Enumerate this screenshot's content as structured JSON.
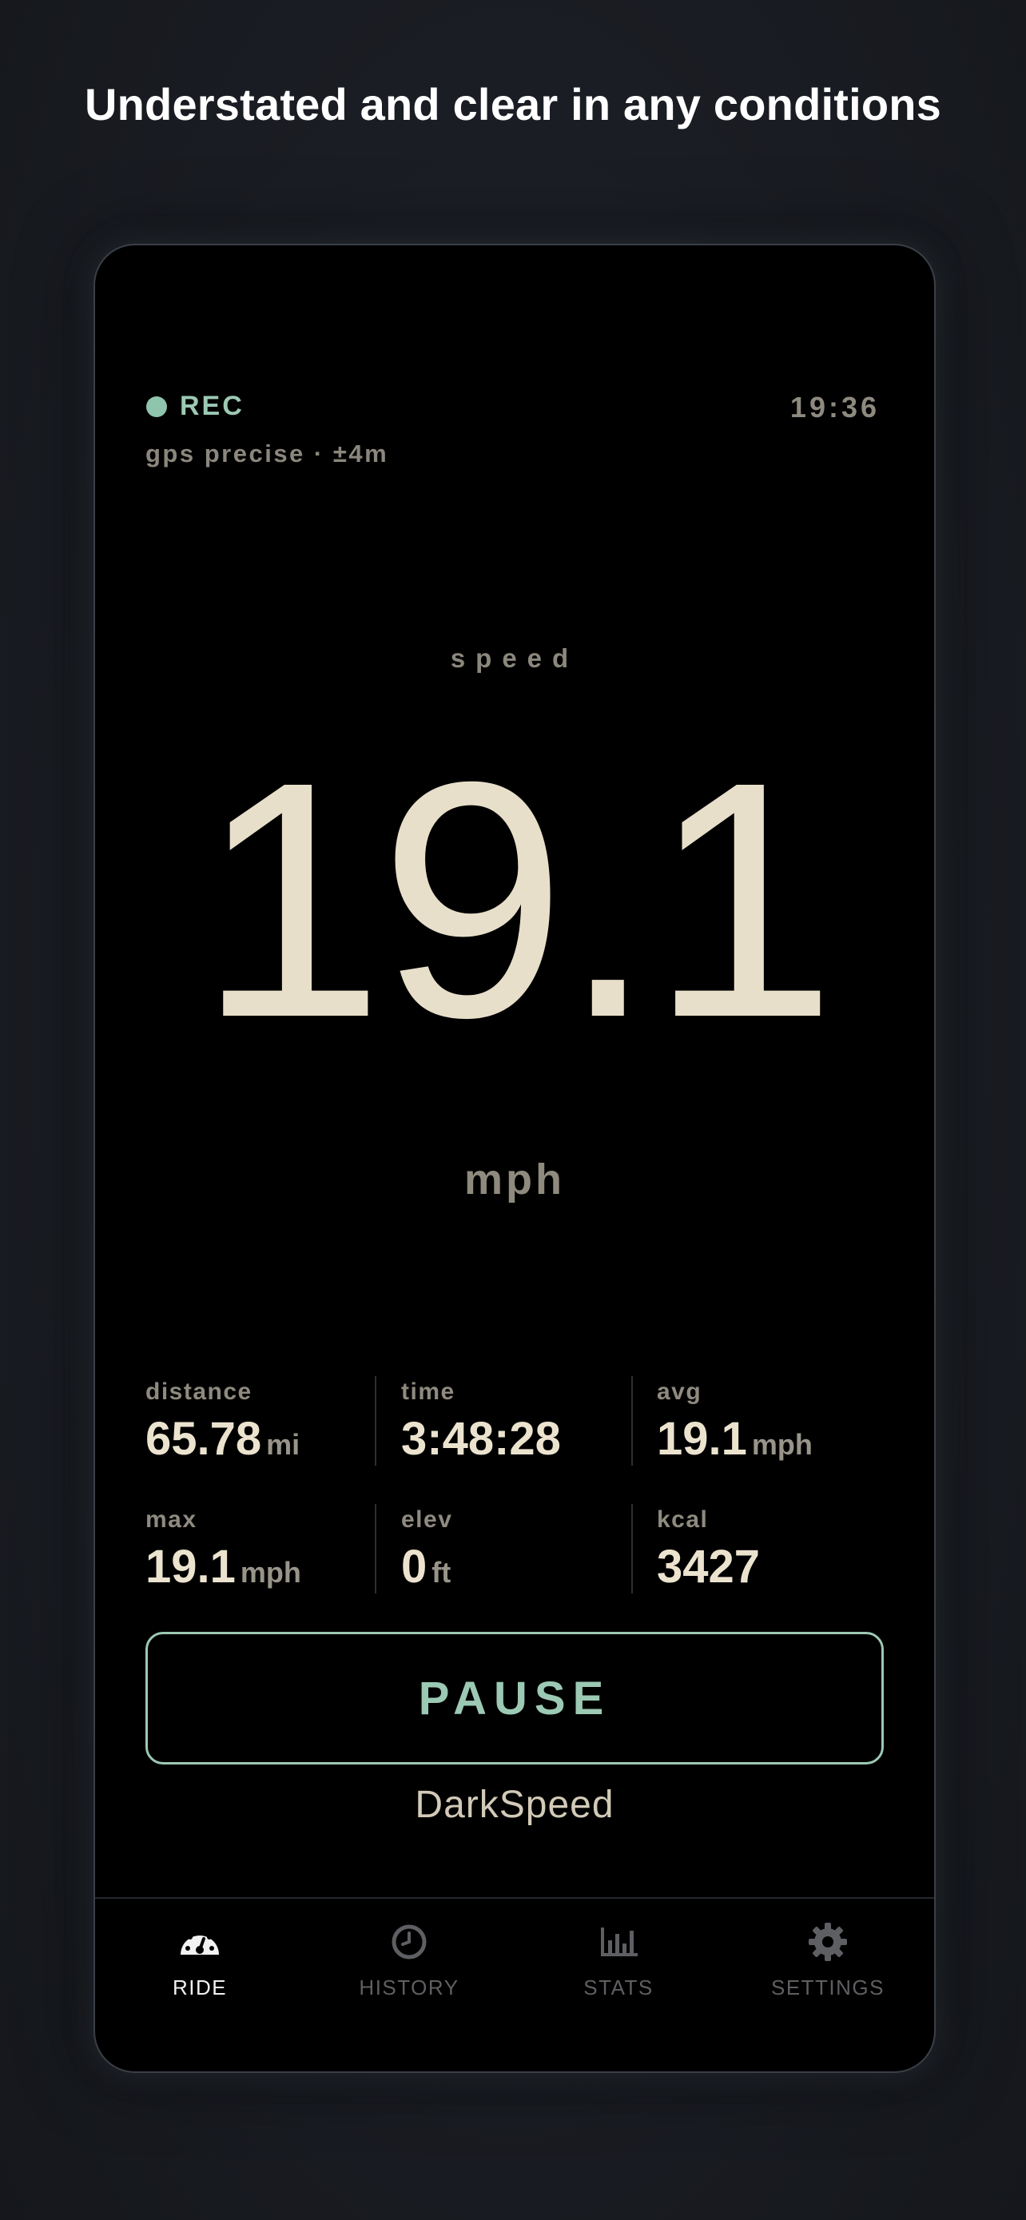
{
  "headline": "Understated and clear in any conditions",
  "status": {
    "recording_label": "REC",
    "clock": "19:36",
    "gps_text": "gps precise · ±4m"
  },
  "speed": {
    "label": "speed",
    "value": "19.1",
    "unit": "mph"
  },
  "stats": [
    {
      "label": "distance",
      "value": "65.78",
      "unit": "mi"
    },
    {
      "label": "time",
      "value": "3:48:28",
      "unit": ""
    },
    {
      "label": "avg",
      "value": "19.1",
      "unit": "mph"
    },
    {
      "label": "max",
      "value": "19.1",
      "unit": "mph"
    },
    {
      "label": "elev",
      "value": "0",
      "unit": "ft"
    },
    {
      "label": "kcal",
      "value": "3427",
      "unit": ""
    }
  ],
  "pause_label": "PAUSE",
  "app_name": "DarkSpeed",
  "tabs": [
    {
      "label": "RIDE",
      "icon": "speedometer-icon",
      "active": true
    },
    {
      "label": "HISTORY",
      "icon": "clock-icon",
      "active": false
    },
    {
      "label": "STATS",
      "icon": "bar-chart-icon",
      "active": false
    },
    {
      "label": "SETTINGS",
      "icon": "gear-icon",
      "active": false
    }
  ],
  "colors": {
    "accent": "#9cc9b4",
    "speed_text": "#e8dfca",
    "background": "#000000"
  }
}
